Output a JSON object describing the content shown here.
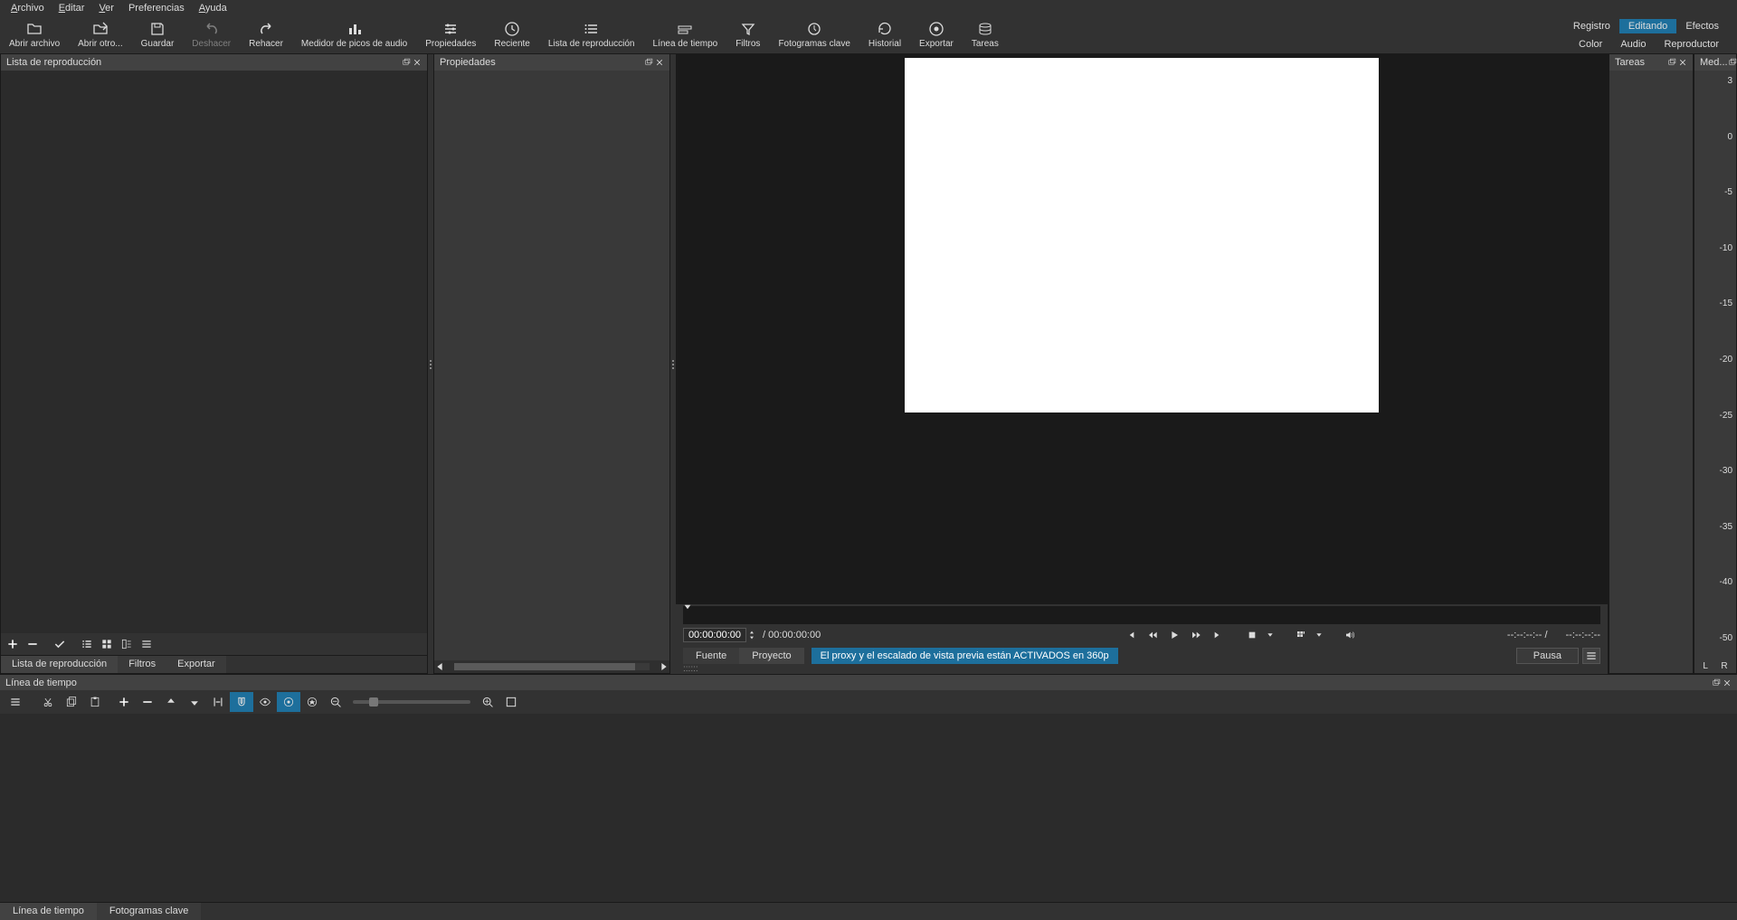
{
  "menu": [
    "Archivo",
    "Editar",
    "Ver",
    "Preferencias",
    "Ayuda"
  ],
  "menu_underline_index": [
    0,
    0,
    0,
    -1,
    0,
    -1
  ],
  "toolbar": {
    "open_file": "Abrir archivo",
    "open_other": "Abrir otro...",
    "save": "Guardar",
    "undo": "Deshacer",
    "redo": "Rehacer",
    "peak": "Medidor de picos de audio",
    "properties": "Propiedades",
    "recent": "Reciente",
    "playlist": "Lista de reproducción",
    "timeline": "Línea de tiempo",
    "filters": "Filtros",
    "keyframes": "Fotogramas clave",
    "history": "Historial",
    "export": "Exportar",
    "jobs": "Tareas"
  },
  "layout_tabs": {
    "logging": "Registro",
    "editing": "Editando",
    "effects": "Efectos"
  },
  "layout_sub": {
    "color": "Color",
    "audio": "Audio",
    "player": "Reproductor"
  },
  "panels": {
    "playlist": "Lista de reproducción",
    "properties": "Propiedades",
    "jobs": "Tareas",
    "meter": "Med...",
    "timeline": "Línea de tiempo"
  },
  "playlist_tabs": {
    "playlist": "Lista de reproducción",
    "filters": "Filtros",
    "export": "Exportar"
  },
  "player": {
    "tc_current": "00:00:00:00",
    "tc_total": "/ 00:00:00:00",
    "tc_in": "--:--:--:--",
    "tc_sep": "/",
    "tc_out": "--:--:--:--",
    "tabs": {
      "source": "Fuente",
      "project": "Proyecto"
    },
    "proxy": "El proxy y el escalado de vista previa están ACTIVADOS en 360p",
    "pause": "Pausa"
  },
  "meter_scale": [
    "3",
    "0",
    "-5",
    "-10",
    "-15",
    "-20",
    "-25",
    "-30",
    "-35",
    "-40",
    "-50"
  ],
  "meter_lr": "L   R",
  "timeline_tabs": {
    "timeline": "Línea de tiempo",
    "keyframes": "Fotogramas clave"
  }
}
